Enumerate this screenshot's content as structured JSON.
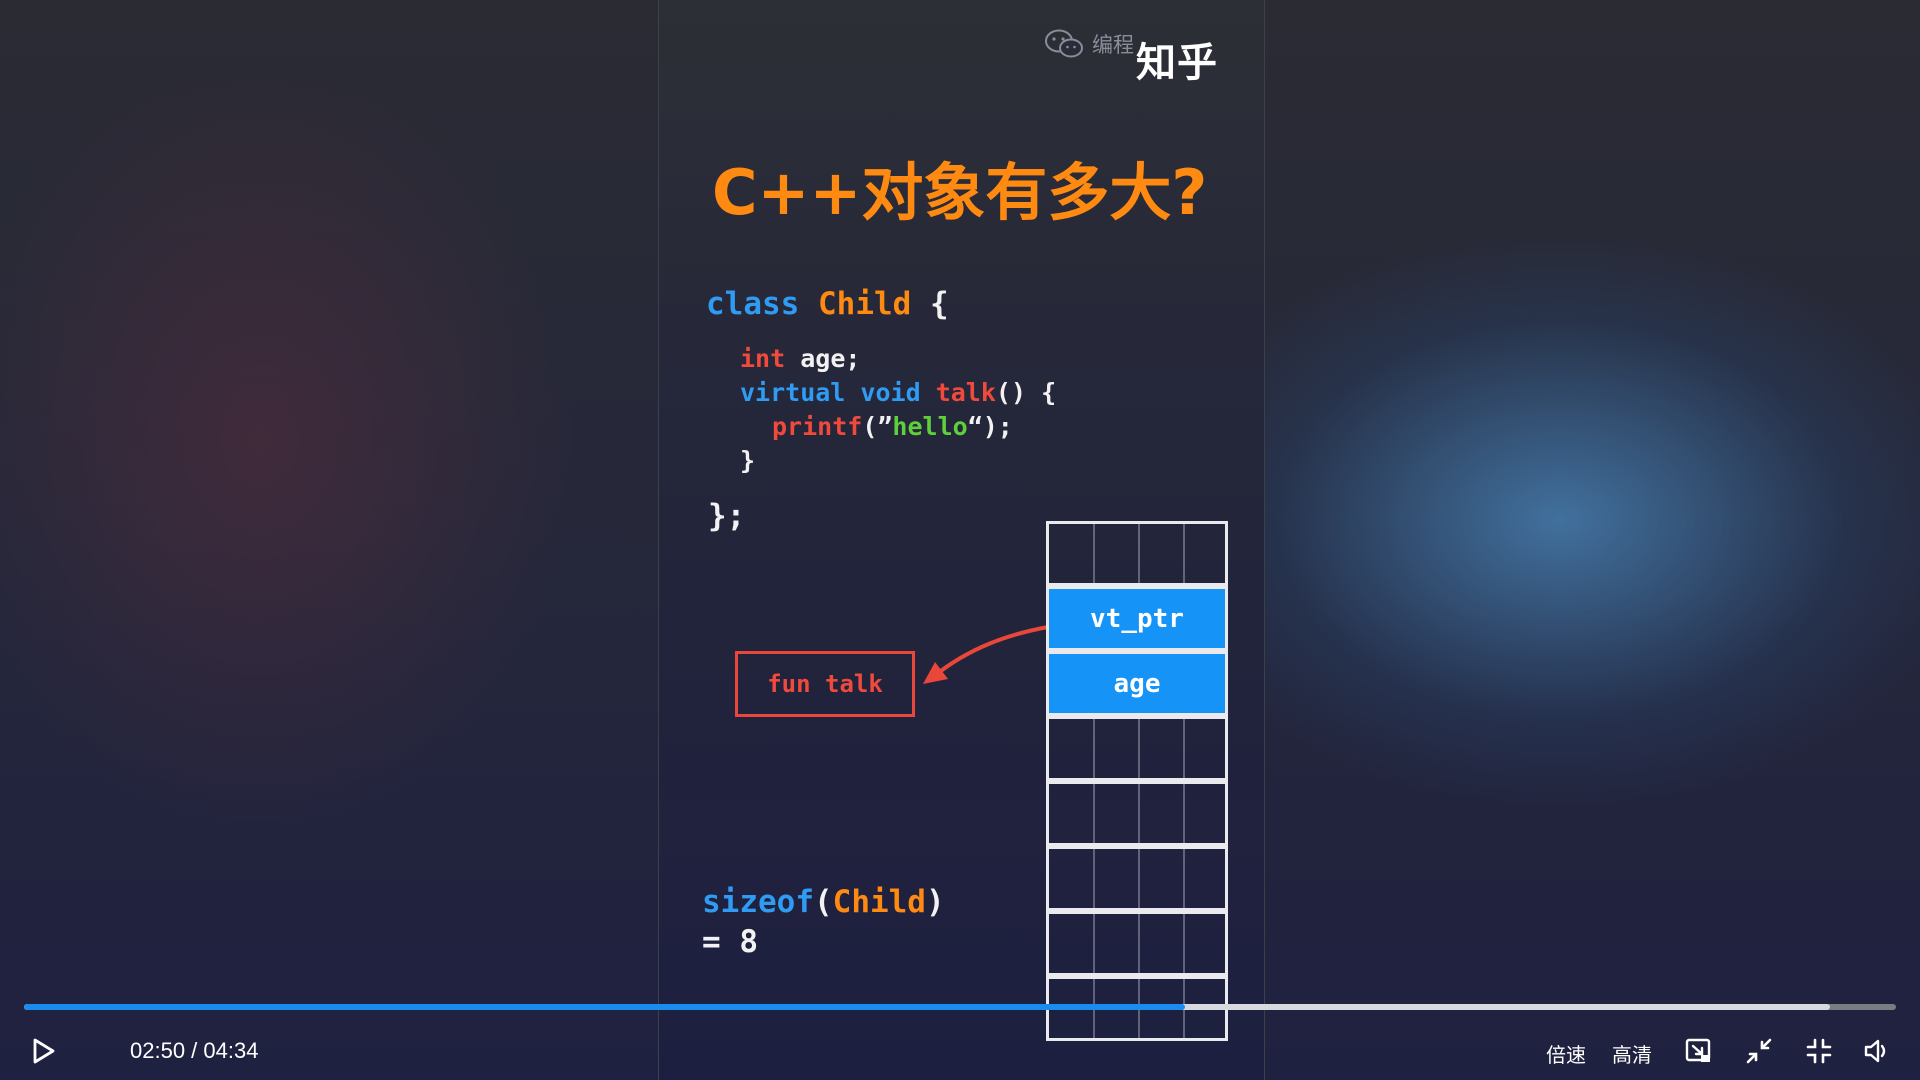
{
  "watermark": {
    "text": "编程",
    "logo": "知乎",
    "icon": "wechat-icon"
  },
  "slide": {
    "title": "C++对象有多大?",
    "code": {
      "line1_kw": "class",
      "line1_name": "Child",
      "line1_brace": "{",
      "line2_type": "int",
      "line2_rest": "age;",
      "line3_virtual": "virtual",
      "line3_void": "void",
      "line3_fn": "talk",
      "line3_rest": "() {",
      "line4_fn": "printf",
      "line4_open": "(”",
      "line4_str": "hello",
      "line4_close": "“);",
      "line5": "}",
      "line6": "};"
    },
    "fun_box": "fun talk",
    "memory_cells": [
      "",
      "vt_ptr",
      "age",
      "",
      "",
      "",
      "",
      ""
    ],
    "sizeof_fn": "sizeof",
    "sizeof_arg": "Child",
    "sizeof_result": "= 8"
  },
  "player": {
    "current_time": "02:50",
    "total_time": "04:34",
    "time_display": "02:50 / 04:34",
    "progress": 0.62,
    "buffered": 0.965,
    "speed_label": "倍速",
    "quality_label": "高清",
    "icons": [
      "play-icon",
      "picture-in-picture-icon",
      "minimize-icon",
      "exit-fullscreen-icon",
      "volume-icon"
    ]
  },
  "colors": {
    "accent_orange": "#ff8a12",
    "keyword_blue": "#2f9bf2",
    "keyword_red": "#f04a3c",
    "string_green": "#5fcf3c",
    "cell_blue": "#1593f6",
    "progress_blue": "#1a8cf0"
  }
}
